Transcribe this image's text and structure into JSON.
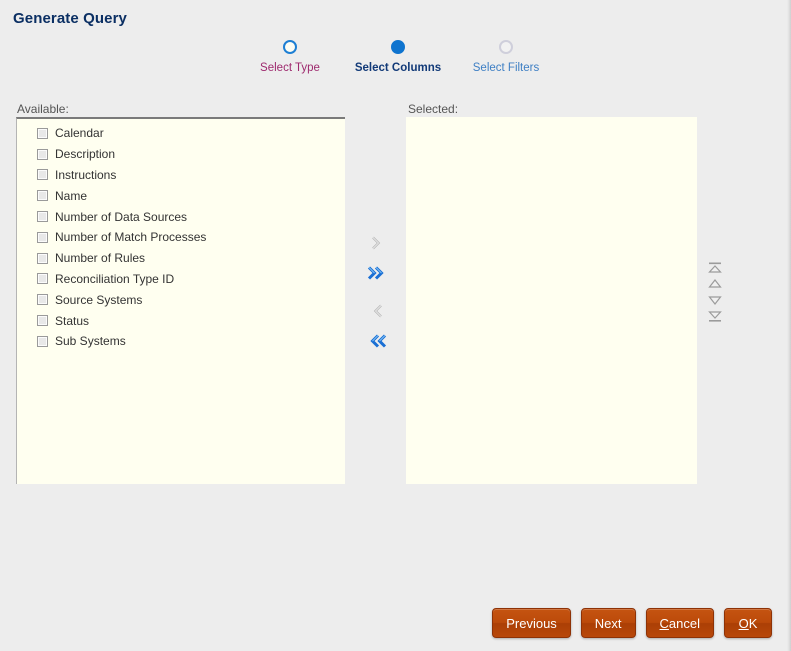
{
  "page": {
    "title": "Generate Query",
    "background_color": "#ededed"
  },
  "stepper": {
    "steps": [
      {
        "label": "Select Type",
        "state": "visited",
        "icon": "step-circle-outline-icon",
        "color": "#9e2a6e"
      },
      {
        "label": "Select Columns",
        "state": "active",
        "icon": "step-circle-filled-icon",
        "color": "#123a78"
      },
      {
        "label": "Select Filters",
        "state": "pending",
        "icon": "step-circle-outline-icon",
        "color": "#3e7fc4"
      }
    ]
  },
  "available_panel": {
    "caption": "Available:",
    "items": [
      "Calendar",
      "Description",
      "Instructions",
      "Name",
      "Number of Data Sources",
      "Number of Match Processes",
      "Number of Rules",
      "Reconciliation Type ID",
      "Source Systems",
      "Status",
      "Sub Systems"
    ]
  },
  "selected_panel": {
    "caption": "Selected:",
    "items": []
  },
  "transfer_buttons": [
    {
      "name": "move-right-icon",
      "title": "Move",
      "state": "disabled",
      "color": "#b3b3b3"
    },
    {
      "name": "move-all-right-icon",
      "title": "Move All",
      "state": "enabled",
      "color": "#1a6fd4"
    },
    {
      "name": "move-left-icon",
      "title": "Remove",
      "state": "disabled",
      "color": "#b3b3b3"
    },
    {
      "name": "move-all-left-icon",
      "title": "Remove All",
      "state": "enabled",
      "color": "#1a6fd4"
    }
  ],
  "reorder_buttons": [
    {
      "name": "move-to-top-icon",
      "title": "Move to Top",
      "state": "disabled",
      "color": "#9b9b9b"
    },
    {
      "name": "move-up-icon",
      "title": "Move Up",
      "state": "disabled",
      "color": "#9b9b9b"
    },
    {
      "name": "move-down-icon",
      "title": "Move Down",
      "state": "disabled",
      "color": "#9b9b9b"
    },
    {
      "name": "move-to-bottom-icon",
      "title": "Move to Bottom",
      "state": "disabled",
      "color": "#9b9b9b"
    }
  ],
  "actions": {
    "previous": {
      "label": "Previous",
      "mnemonic": ""
    },
    "next": {
      "label": "Next",
      "mnemonic": ""
    },
    "cancel": {
      "label": "ancel",
      "mnemonic": "C"
    },
    "ok": {
      "label": "K",
      "mnemonic": "O"
    },
    "color": "#b8480a"
  }
}
